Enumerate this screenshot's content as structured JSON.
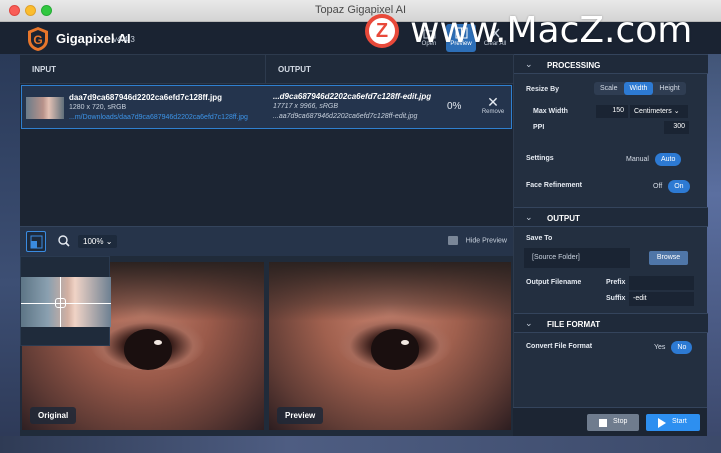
{
  "window": {
    "title": "Topaz Gigapixel AI"
  },
  "app": {
    "name": "Gigapixel AI",
    "version": "v4.4.3"
  },
  "header_buttons": [
    {
      "label": "Open",
      "icon": "open-icon"
    },
    {
      "label": "Preview",
      "icon": "preview-icon",
      "active": true
    },
    {
      "label": "Clear All",
      "icon": "clear-all-icon"
    }
  ],
  "watermark": {
    "logo": "Z",
    "text": "www.MacZ.com"
  },
  "table": {
    "col_input": "INPUT",
    "col_output": "OUTPUT",
    "row": {
      "input_name": "daa7d9ca687946d2202ca6efd7c128ff.jpg",
      "input_meta": "1280 x 720, sRGB",
      "input_path": "...m/Downloads/daa7d9ca687946d2202ca6efd7c128ff.jpg",
      "output_name": "...d9ca687946d2202ca6efd7c128ff-edit.jpg",
      "output_meta": "17717 x 9966, sRGB",
      "output_path": "...aa7d9ca687946d2202ca6efd7c128ff-edit.jpg",
      "progress": "0%",
      "remove_label": "Remove"
    }
  },
  "preview_toolbar": {
    "zoom": "100%",
    "hide_preview": "Hide Preview"
  },
  "preview": {
    "left_label": "Original",
    "right_label": "Preview"
  },
  "processing": {
    "title": "PROCESSING",
    "resize_by_label": "Resize By",
    "resize_options": [
      "Scale",
      "Width",
      "Height"
    ],
    "resize_selected": "Width",
    "max_width_label": "Max Width",
    "max_width_value": "150",
    "unit": "Centimeters",
    "ppi_label": "PPI",
    "ppi_value": "300",
    "settings_label": "Settings",
    "settings_options": [
      "Manual",
      "Auto"
    ],
    "settings_selected": "Auto",
    "face_label": "Face Refinement",
    "face_options": [
      "Off",
      "On"
    ],
    "face_selected": "On"
  },
  "output": {
    "title": "OUTPUT",
    "save_to_label": "Save To",
    "save_to_value": "[Source Folder]",
    "browse_label": "Browse",
    "filename_label": "Output Filename",
    "prefix_label": "Prefix",
    "prefix_value": "",
    "suffix_label": "Suffix",
    "suffix_value": "-edit"
  },
  "file_format": {
    "title": "FILE FORMAT",
    "convert_label": "Convert File Format",
    "options": [
      "Yes",
      "No"
    ],
    "selected": "No"
  },
  "footer": {
    "stop_label": "Stop",
    "start_label": "Start"
  },
  "colors": {
    "accent": "#2d7ad3",
    "panel": "#232f40",
    "background": "#1c2533",
    "start": "#2d8ff0"
  }
}
